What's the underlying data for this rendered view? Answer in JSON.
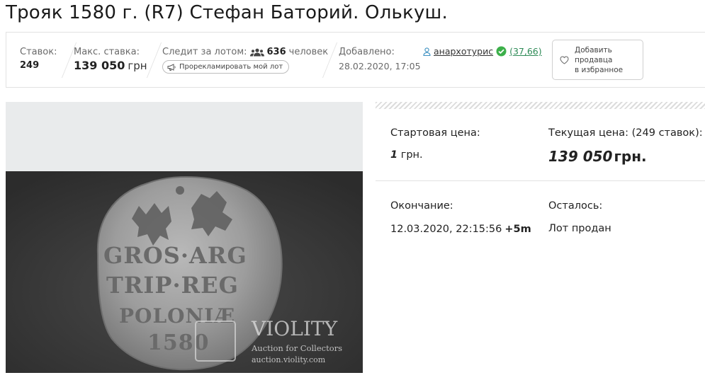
{
  "title": "Трояк 1580 г. (R7) Стефан Баторий. Олькуш.",
  "info": {
    "bids_label": "Ставок:",
    "bids_value": "249",
    "max_bid_label": "Макс. ставка:",
    "max_bid_value": "139 050",
    "max_bid_currency": "грн",
    "watching_label": "Следит за лотом:",
    "watching_count": "636",
    "watching_unit": "человек",
    "promote_label": "Прорекламировать мой лот",
    "added_label": "Добавлено:",
    "added_value": "28.02.2020, 17:05",
    "seller_name": "анархотурис",
    "seller_rating": "(37,66)",
    "favorite_label": [
      "Добавить",
      "продавца",
      "в избранное"
    ]
  },
  "photo": {
    "coin_legend": [
      "GROS·ARG",
      "TRIP·REG",
      "POLONIÆ",
      "1580"
    ],
    "watermark_title": "VIOLITY",
    "watermark_sub": "Auction for Collectors",
    "watermark_url": "auction.violity.com"
  },
  "price": {
    "start_label": "Стартовая цена:",
    "start_value": "1",
    "start_currency": "грн.",
    "current_label": "Текущая цена: (249 ставок):",
    "current_value": "139 050",
    "current_currency": "грн.",
    "end_label": "Окончание:",
    "end_value": "12.03.2020, 22:15:56",
    "end_extra": "+5m",
    "remaining_label": "Осталось:",
    "remaining_value": "Лот продан"
  },
  "colors": {
    "accent_green": "#2e8b57",
    "verified_green": "#3cb04a",
    "border": "#e2e2e2"
  },
  "icons": [
    "users-icon",
    "megaphone-icon",
    "user-icon",
    "verified-check-icon",
    "heart-icon"
  ]
}
